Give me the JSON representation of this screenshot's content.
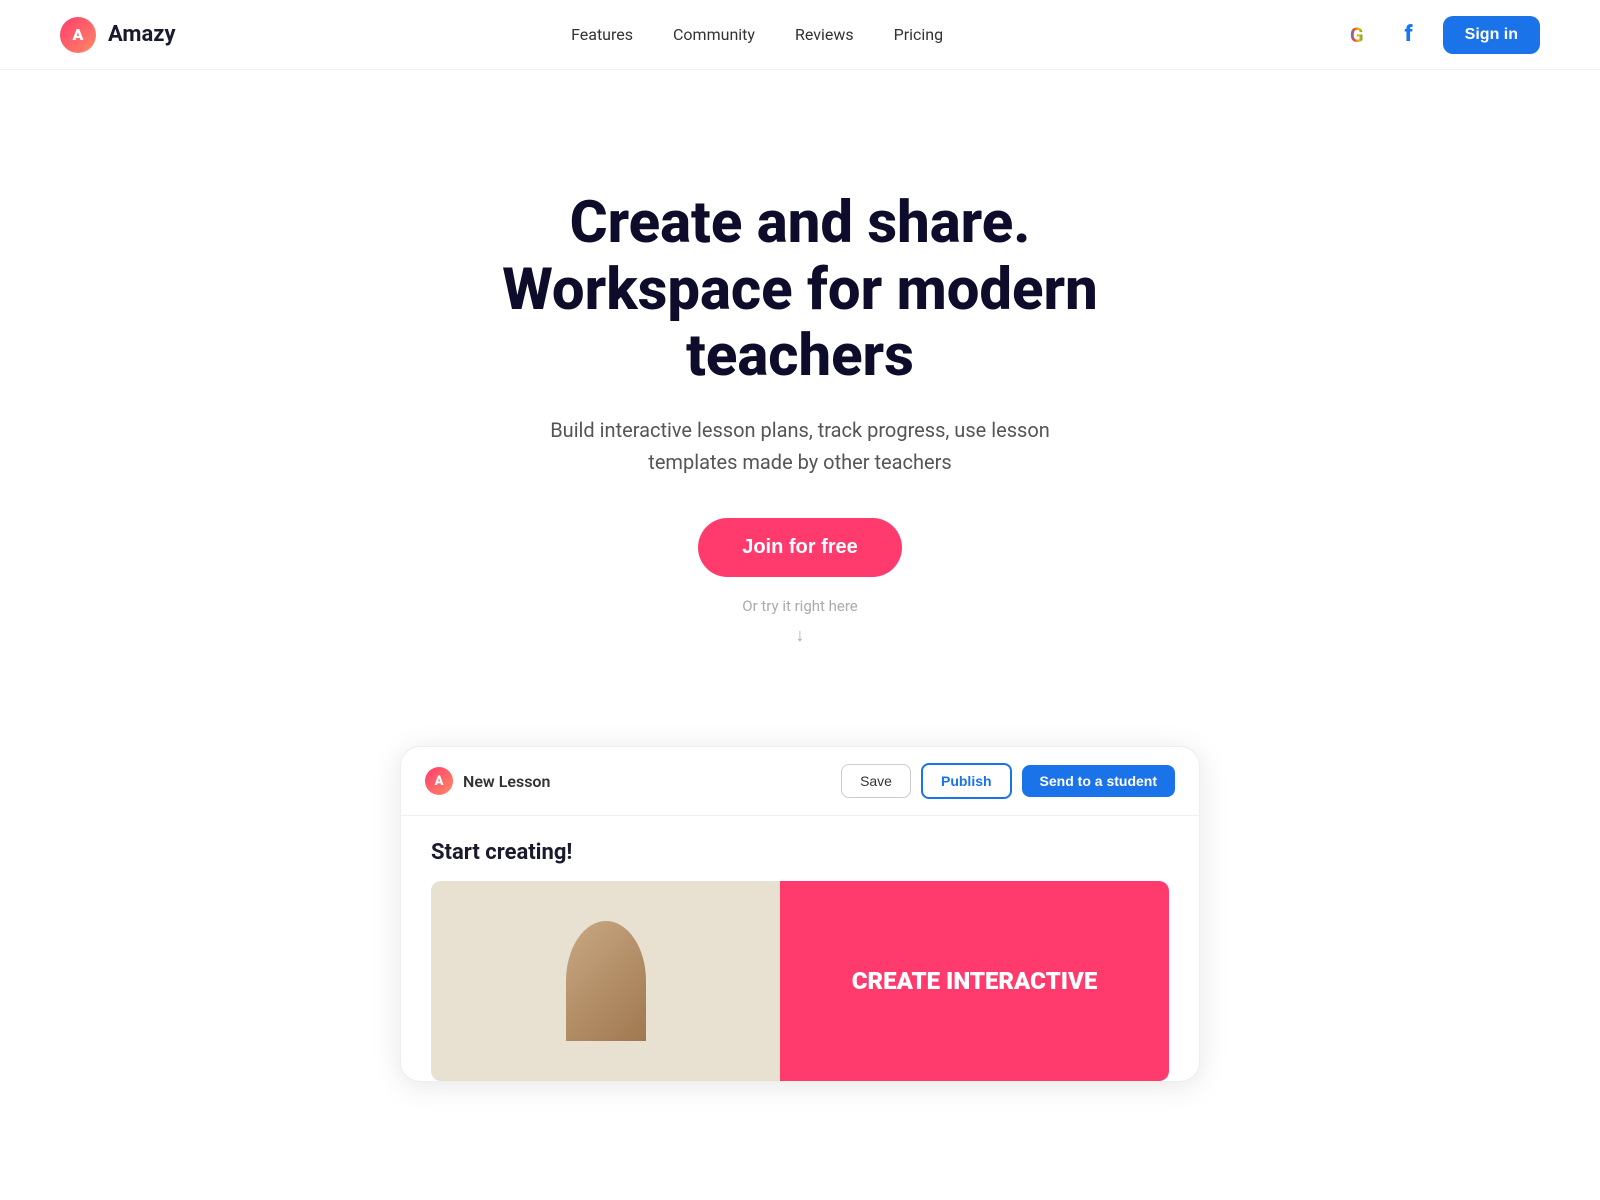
{
  "navbar": {
    "logo_text": "Amazy",
    "nav_links": [
      {
        "label": "Features",
        "id": "features"
      },
      {
        "label": "Community",
        "id": "community"
      },
      {
        "label": "Reviews",
        "id": "reviews"
      },
      {
        "label": "Pricing",
        "id": "pricing"
      }
    ],
    "sign_in_label": "Sign in"
  },
  "hero": {
    "title_line1": "Create and share.",
    "title_line2": "Workspace for modern teachers",
    "subtitle": "Build interactive lesson plans, track progress, use lesson templates made by other teachers",
    "join_label": "Join for free",
    "try_label": "Or try it right here"
  },
  "demo_card": {
    "title": "New Lesson",
    "save_label": "Save",
    "publish_label": "Publish",
    "send_label": "Send to a student",
    "body_title": "Start creating!",
    "image_text": "CREATE INTERACTIVE"
  }
}
